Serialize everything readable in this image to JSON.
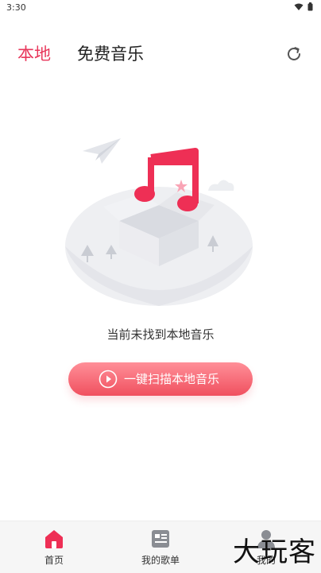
{
  "status": {
    "time": "3:30"
  },
  "tabs": {
    "local": "本地",
    "free_music": "免费音乐"
  },
  "empty": {
    "message": "当前未找到本地音乐"
  },
  "scan": {
    "label": "一键扫描本地音乐"
  },
  "nav": {
    "home": "首页",
    "playlist": "我的歌单",
    "mine": "我的"
  },
  "watermark": "大玩客",
  "colors": {
    "accent": "#e8375b",
    "button_top": "#ff8f98",
    "button_bottom": "#f0505f"
  },
  "icons": [
    "wifi-icon",
    "battery-icon",
    "refresh-icon",
    "music-note-icon",
    "play-icon",
    "home-icon",
    "playlist-icon",
    "user-icon"
  ]
}
